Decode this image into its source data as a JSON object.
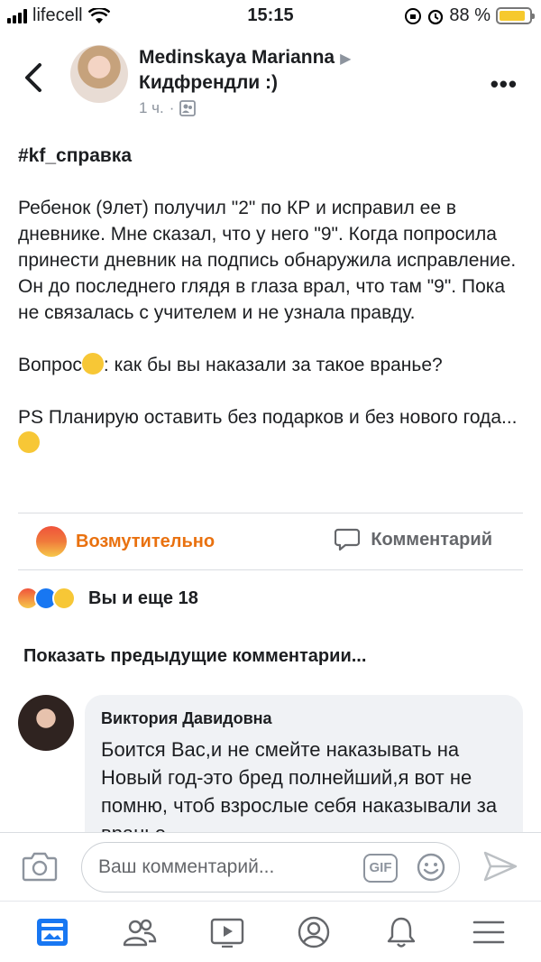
{
  "status_bar": {
    "carrier": "lifecell",
    "time": "15:15",
    "battery": "88 %",
    "battery_level": 0.88
  },
  "header": {
    "author": "Medinskaya Marianna",
    "group": "Кидфрендли :)",
    "time": "1 ч.",
    "icons": {
      "back": "chevron-left-icon",
      "more": "more-dots-icon",
      "audience": "group-icon"
    }
  },
  "post": {
    "hashtag": "#kf_справка",
    "paragraph1": "Ребенок (9лет) получил \"2\" по КР и исправил ее в дневнике. Мне сказал, что у него \"9\". Когда попросила принести дневник на подпись обнаружила исправление.  Он до последнего глядя в глаза врал, что там \"9\". Пока не связалась с учителем и не узнала правду.",
    "question_start": "Вопрос",
    "question_rest": ": как бы вы наказали за такое вранье?",
    "ps": "PS Планирую оставить без подарков и без нового года..."
  },
  "actions": {
    "reaction_label": "Возмутительно",
    "comment_label": "Комментарий",
    "reaction_color": "#e9710f"
  },
  "reactions_summary": {
    "text": "Вы и еще 18"
  },
  "comments": {
    "show_previous": "Показать предыдущие комментарии...",
    "items": [
      {
        "author": "Виктория Давидовна",
        "text": "Боится  Вас,и не смейте наказывать на Новый год-это бред полнейший,я вот не помню, чтоб взрослые себя наказывали за вранье"
      }
    ]
  },
  "composer": {
    "placeholder": "Ваш комментарий...",
    "gif_label": "GIF"
  },
  "bottom_nav": {
    "items": [
      "news-feed-icon",
      "friends-icon",
      "watch-icon",
      "profile-icon",
      "notifications-icon",
      "menu-icon"
    ]
  }
}
